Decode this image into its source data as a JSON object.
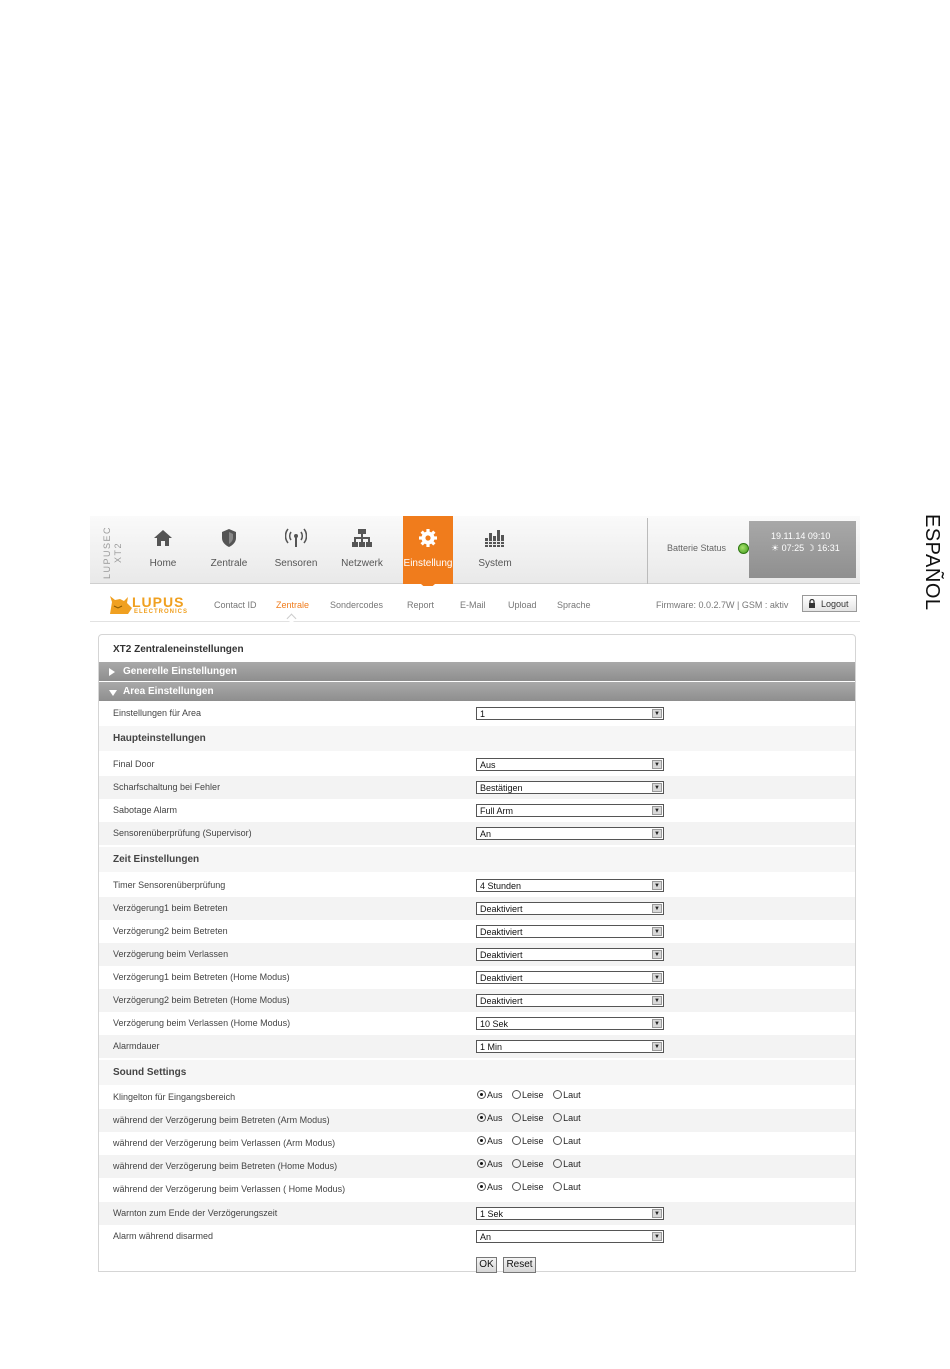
{
  "side_label": "ESPAÑOL",
  "topbar": {
    "brand": "LUPUSEC XT2",
    "nav": [
      {
        "label": "Home",
        "icon": "home-icon"
      },
      {
        "label": "Zentrale",
        "icon": "shield-icon"
      },
      {
        "label": "Sensoren",
        "icon": "antenna-icon"
      },
      {
        "label": "Netzwerk",
        "icon": "network-icon"
      },
      {
        "label": "Einstellung",
        "icon": "gear-icon",
        "active": true
      },
      {
        "label": "System",
        "icon": "bars-icon"
      }
    ],
    "battery_label": "Batterie Status",
    "battery_color": "#3f9a1c",
    "datetime": "19.11.14 09:10",
    "sunrise": "07:25",
    "sunset": "16:31"
  },
  "subnav": {
    "logo_text": "LUPUS",
    "logo_sub": "ELECTRONICS",
    "links": [
      "Contact ID",
      "Zentrale",
      "Sondercodes",
      "Report",
      "E-Mail",
      "Upload",
      "Sprache"
    ],
    "active": "Zentrale",
    "firmware": "Firmware: 0.0.2.7W | GSM : aktiv",
    "logout": "Logout"
  },
  "colors": {
    "accent": "#f07c1c",
    "section_bar": "#999999"
  },
  "panel": {
    "title": "XT2 Zentraleneinstellungen",
    "section_general": "Generelle Einstellungen",
    "section_area": "Area Einstellungen",
    "area_row": {
      "label": "Einstellungen für Area",
      "value": "1"
    },
    "haupt_heading": "Haupteinstellungen",
    "haupt": [
      {
        "label": "Final Door",
        "value": "Aus"
      },
      {
        "label": "Scharfschaltung bei Fehler",
        "value": "Bestätigen"
      },
      {
        "label": "Sabotage Alarm",
        "value": "Full Arm"
      },
      {
        "label": "Sensorenüberprüfung (Supervisor)",
        "value": "An"
      }
    ],
    "zeit_heading": "Zeit Einstellungen",
    "zeit": [
      {
        "label": "Timer Sensorenüberprüfung",
        "value": "4 Stunden"
      },
      {
        "label": "Verzögerung1 beim Betreten",
        "value": "Deaktiviert"
      },
      {
        "label": "Verzögerung2 beim Betreten",
        "value": "Deaktiviert"
      },
      {
        "label": "Verzögerung beim Verlassen",
        "value": "Deaktiviert"
      },
      {
        "label": "Verzögerung1 beim Betreten (Home Modus)",
        "value": "Deaktiviert"
      },
      {
        "label": "Verzögerung2 beim Betreten (Home Modus)",
        "value": "Deaktiviert"
      },
      {
        "label": "Verzögerung beim Verlassen (Home Modus)",
        "value": "10 Sek"
      },
      {
        "label": "Alarmdauer",
        "value": "1 Min"
      }
    ],
    "sound_heading": "Sound Settings",
    "radio_options": [
      "Aus",
      "Leise",
      "Laut"
    ],
    "sound_radios": [
      {
        "label": "Klingelton für Eingangsbereich",
        "selected": "Aus"
      },
      {
        "label": "während der Verzögerung beim Betreten (Arm Modus)",
        "selected": "Aus"
      },
      {
        "label": "während der Verzögerung beim Verlassen (Arm Modus)",
        "selected": "Aus"
      },
      {
        "label": "während der Verzögerung beim Betreten (Home Modus)",
        "selected": "Aus"
      },
      {
        "label": "während der Verzögerung beim Verlassen ( Home Modus)",
        "selected": "Aus"
      }
    ],
    "sound_selects": [
      {
        "label": "Warnton zum Ende der Verzögerungszeit",
        "value": "1 Sek"
      },
      {
        "label": "Alarm während disarmed",
        "value": "An"
      }
    ],
    "ok_label": "OK",
    "reset_label": "Reset"
  }
}
